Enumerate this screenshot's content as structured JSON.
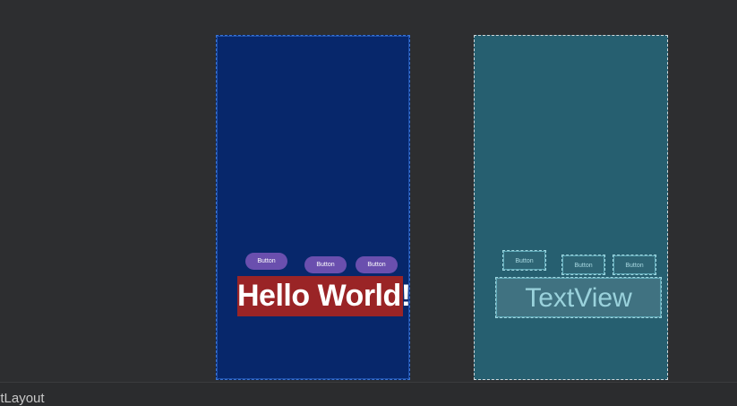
{
  "design_view": {
    "buttons": [
      {
        "label": "Button"
      },
      {
        "label": "Button"
      },
      {
        "label": "Button"
      }
    ],
    "text_view": {
      "text": "Hello World!"
    }
  },
  "blueprint_view": {
    "buttons": [
      {
        "label": "Button"
      },
      {
        "label": "Button"
      },
      {
        "label": "Button"
      }
    ],
    "text_view": {
      "text": "TextView"
    }
  },
  "status_bar": {
    "label": "ntLayout"
  },
  "colors": {
    "canvas_background": "#2d2e30",
    "design_background": "#07276b",
    "blueprint_background": "#265f70",
    "button_fill": "#6a4fae",
    "textview_fill": "#9a2426"
  }
}
